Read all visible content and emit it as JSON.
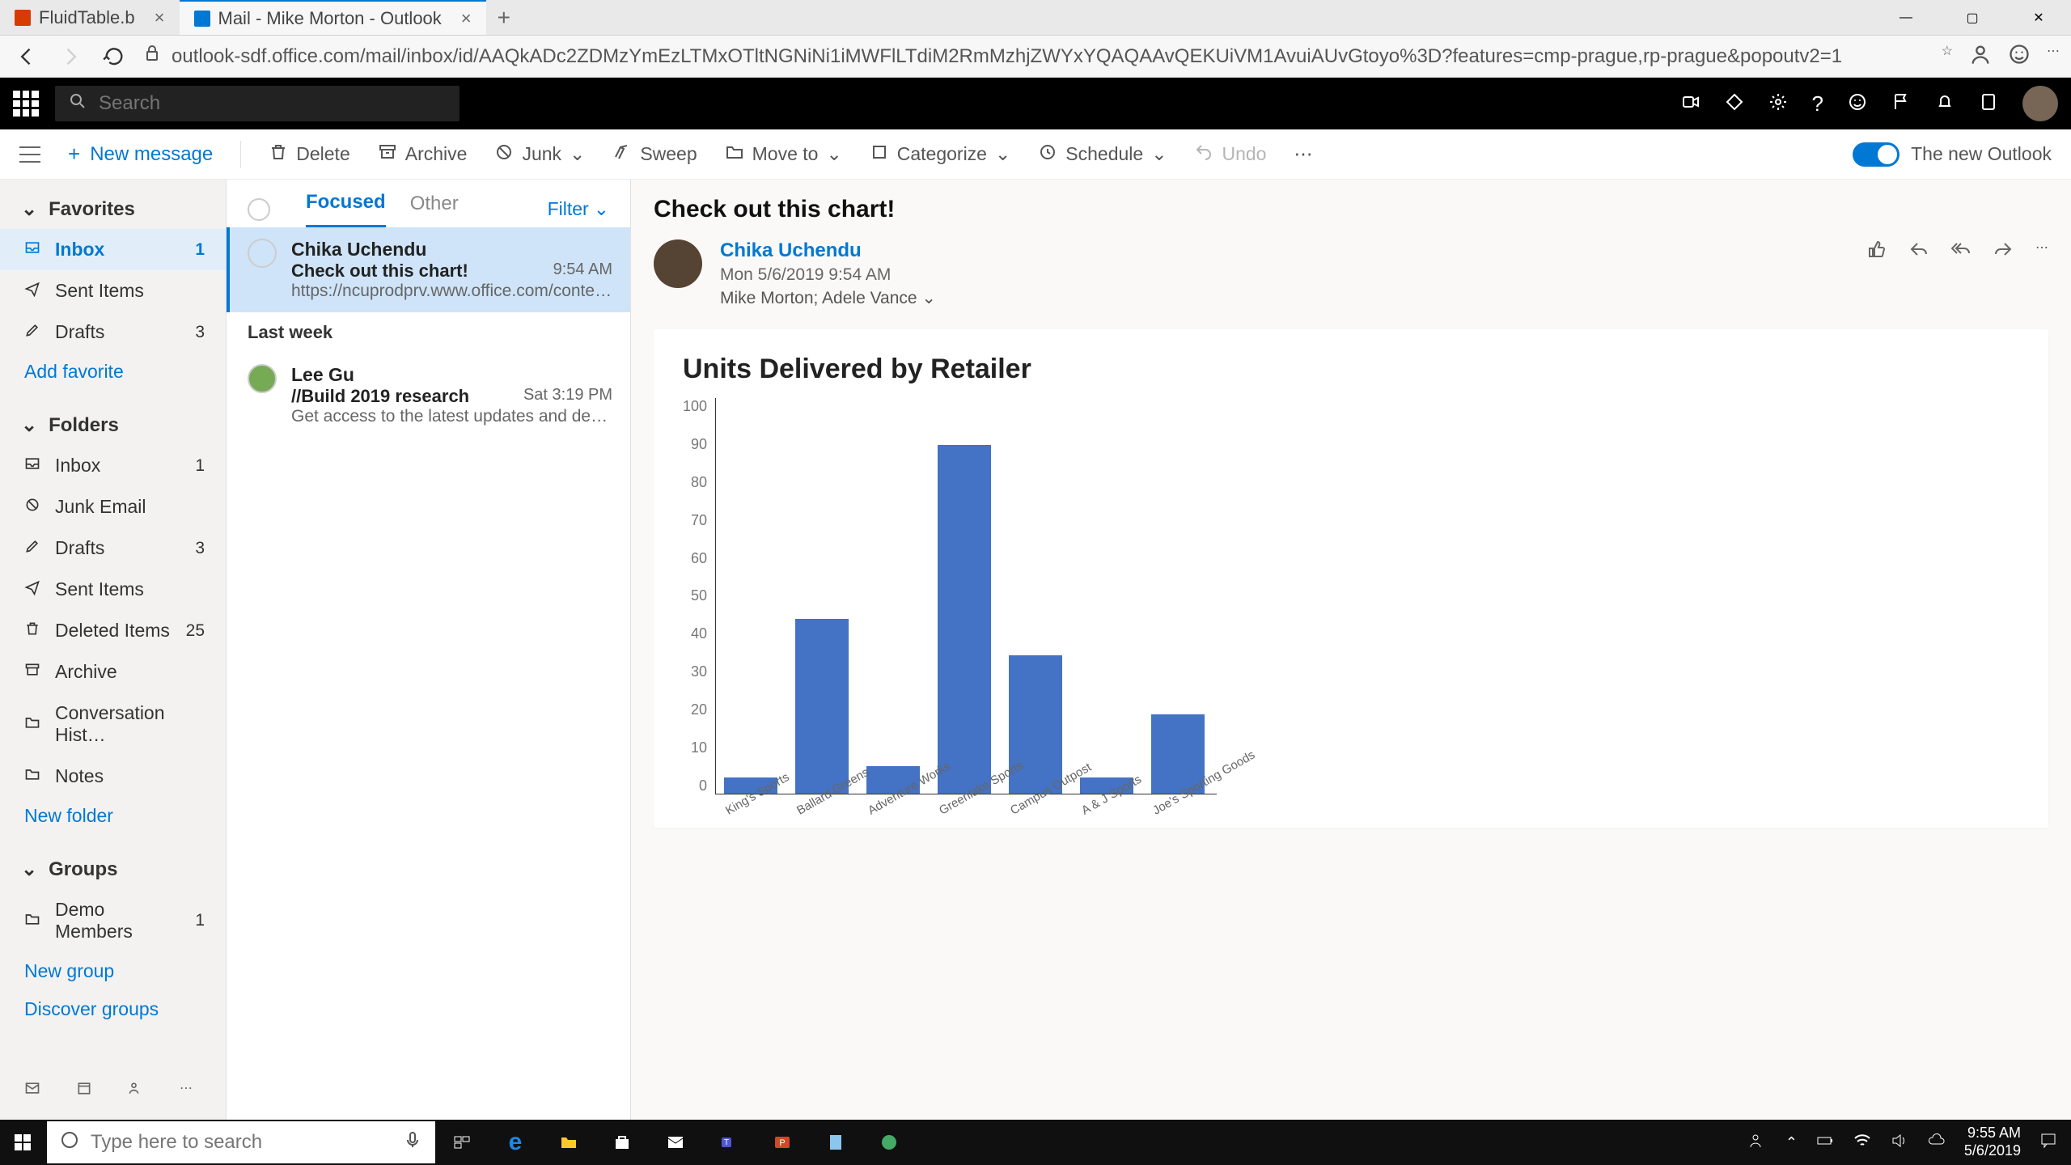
{
  "browser": {
    "tabs": [
      {
        "label": "FluidTable.b",
        "icon_color": "#d83b01"
      },
      {
        "label": "Mail - Mike Morton - Outlook",
        "icon_color": "#0078d4"
      }
    ],
    "url": "outlook-sdf.office.com/mail/inbox/id/AAQkADc2ZDMzYmEzLTMxOTltNGNiNi1iMWFlLTdiM2RmMzhjZWYxYQAQAAvQEKUiVM1AvuiAUvGtoyo%3D?features=cmp-prague,rp-prague&popoutv2=1"
  },
  "search": {
    "placeholder": "Search"
  },
  "cmdbar": {
    "new_message": "New message",
    "delete": "Delete",
    "archive": "Archive",
    "junk": "Junk",
    "sweep": "Sweep",
    "moveto": "Move to",
    "categorize": "Categorize",
    "schedule": "Schedule",
    "undo": "Undo",
    "toggle_label": "The new Outlook"
  },
  "leftnav": {
    "favorites_label": "Favorites",
    "folders_label": "Folders",
    "groups_label": "Groups",
    "add_favorite": "Add favorite",
    "new_folder": "New folder",
    "new_group": "New group",
    "discover_groups": "Discover groups",
    "favorites": [
      {
        "label": "Inbox",
        "count": "1",
        "selected": true
      },
      {
        "label": "Sent Items",
        "count": ""
      },
      {
        "label": "Drafts",
        "count": "3"
      }
    ],
    "folders": [
      {
        "label": "Inbox",
        "count": "1"
      },
      {
        "label": "Junk Email",
        "count": ""
      },
      {
        "label": "Drafts",
        "count": "3"
      },
      {
        "label": "Sent Items",
        "count": ""
      },
      {
        "label": "Deleted Items",
        "count": "25"
      },
      {
        "label": "Archive",
        "count": ""
      },
      {
        "label": "Conversation Hist…",
        "count": ""
      },
      {
        "label": "Notes",
        "count": ""
      }
    ],
    "groups": [
      {
        "label": "Demo Members",
        "count": "1"
      }
    ]
  },
  "msglist": {
    "tabs": {
      "focused": "Focused",
      "other": "Other"
    },
    "filter": "Filter",
    "group_lastweek": "Last week",
    "items": [
      {
        "from": "Chika Uchendu",
        "subject": "Check out this chart!",
        "time": "9:54 AM",
        "preview": "https://ncuprodprv.www.office.com/content/bo…",
        "selected": true
      },
      {
        "from": "Lee Gu",
        "subject": "//Build 2019 research",
        "time": "Sat 3:19 PM",
        "preview": "Get access to the latest updates and developme…",
        "selected": false
      }
    ]
  },
  "reading": {
    "subject": "Check out this chart!",
    "from": "Chika Uchendu",
    "date": "Mon 5/6/2019 9:54 AM",
    "to": "Mike Morton; Adele Vance"
  },
  "chart_data": {
    "type": "bar",
    "title": "Units Delivered by Retailer",
    "categories": [
      "King's Sports",
      "Ballard Greens",
      "Adventure Works",
      "Greenlake Sports",
      "Campus Outpost",
      "A & J Sports",
      "Joe's Sporting Goods"
    ],
    "values": [
      4,
      44,
      7,
      88,
      35,
      4,
      20
    ],
    "ylim": [
      0,
      100
    ],
    "yticks": [
      100,
      90,
      80,
      70,
      60,
      50,
      40,
      30,
      20,
      10,
      0
    ]
  },
  "taskbar": {
    "search_placeholder": "Type here to search",
    "time": "9:55 AM",
    "date": "5/6/2019"
  }
}
